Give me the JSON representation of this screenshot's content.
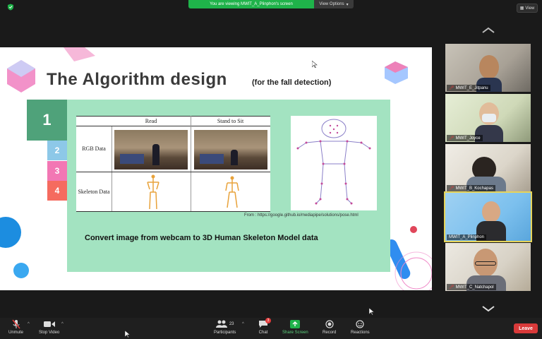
{
  "banner": {
    "viewing_text": "You are viewing MWIT_A_Plinphon's screen",
    "view_options": "View Options"
  },
  "top_right": {
    "view_label": "View"
  },
  "slide": {
    "title": "The Algorithm design",
    "subtitle": "(for the fall detection)",
    "main_number": "1",
    "side_numbers": [
      "2",
      "3",
      "4"
    ],
    "table": {
      "headers": [
        "Read",
        "Stand to Sit"
      ],
      "row1_label": "RGB Data",
      "row2_label": "Skeleton Data"
    },
    "source_text": "From : https://google.github.io/mediapipe/solutions/pose.html",
    "caption": "Convert image from webcam to 3D Human Skeleton Model data"
  },
  "participants": [
    {
      "name": "MWIT_E_Jitpanu",
      "muted": true
    },
    {
      "name": "MWIT_Joyce",
      "muted": true
    },
    {
      "name": "MWIT_B_Kochapas",
      "muted": true
    },
    {
      "name": "MWIT_A_Plinphon",
      "muted": false,
      "active": true
    },
    {
      "name": "MWIT_C_Natchapol",
      "muted": true
    }
  ],
  "toolbar": {
    "unmute": "Unmute",
    "stop_video": "Stop Video",
    "participants": "Participants",
    "participants_count": "23",
    "chat": "Chat",
    "chat_badge": "3",
    "share_screen": "Share Screen",
    "record": "Record",
    "reactions": "Reactions",
    "leave": "Leave"
  },
  "colors": {
    "share_green": "#1fb34a",
    "slide_panel": "#a3e3c1",
    "leave_red": "#d93a3a",
    "active_tile": "#e6d45a"
  }
}
